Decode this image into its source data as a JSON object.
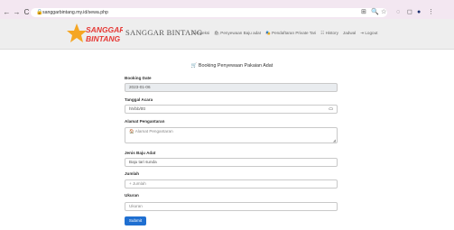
{
  "browser": {
    "url": "sanggarbintang.my.id/sewa.php",
    "nav_icons": {
      "back": "←",
      "forward": "→",
      "reload": "C",
      "lock": "🔒"
    },
    "toolbar_icons": [
      "⊞",
      "🔍",
      "☆",
      "◌",
      "◻",
      "●",
      "⋮"
    ]
  },
  "site": {
    "logo_line1": "SANGGAR",
    "logo_line2": "BINTANG",
    "brand": "SANGGAR BINTANG",
    "menu": [
      "☰ Koleksi",
      "🛍 Penyewaan Baju adat",
      "🎭 Pendaftaran Private Tari",
      "☷ History",
      "Jadwal",
      "⇥ Logout"
    ]
  },
  "form": {
    "title": "🛒 Booking Penyewaan Pakaian Adat",
    "booking_date_label": "Booking Date",
    "booking_date_value": "2023-01-06",
    "event_date_label": "Tanggal Acara",
    "event_date_value": "hh/bb/tttt",
    "address_label": "Alamat Pengantaran",
    "address_placeholder": "🏠 Alamat Pengantaran",
    "costume_label": "Jenis Baju Adat",
    "costume_value": "Baju tari sunda",
    "qty_label": "Jumlah",
    "qty_placeholder": "+ Jumlah",
    "size_label": "Ukuran",
    "size_placeholder": "Ukuran",
    "submit_label": "Submit"
  },
  "colors": {
    "accent": "#1f6fd1",
    "logo_red": "#e53935",
    "logo_star": "#f5a623"
  }
}
